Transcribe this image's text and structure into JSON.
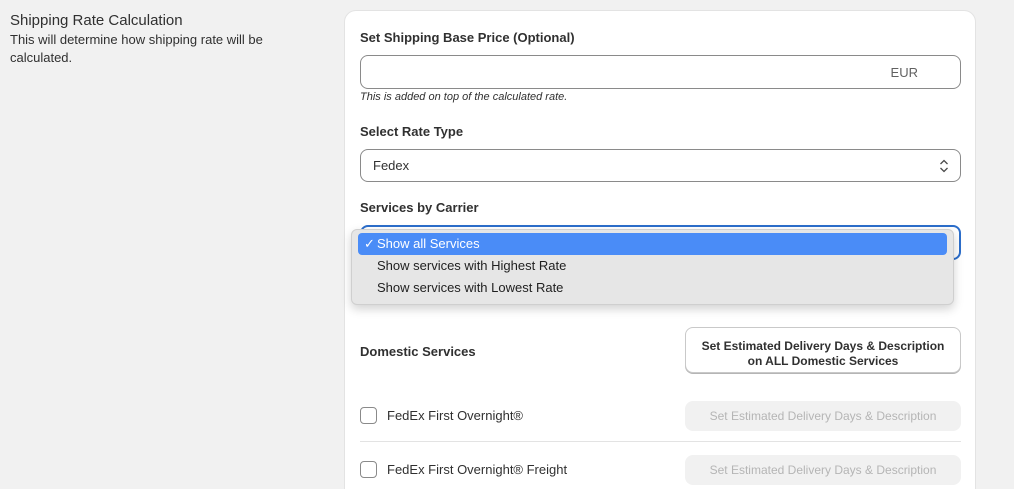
{
  "section": {
    "title": "Shipping Rate Calculation",
    "description": "This will determine how shipping rate will be calculated."
  },
  "base_price": {
    "label": "Set Shipping Base Price (Optional)",
    "value": "",
    "suffix": "EUR",
    "help": "This is added on top of the calculated rate."
  },
  "rate_type": {
    "label": "Select Rate Type",
    "selected": "Fedex"
  },
  "services_by_carrier": {
    "label": "Services by Carrier",
    "options": [
      {
        "label": "Show all Services",
        "selected": true
      },
      {
        "label": "Show services with Highest Rate",
        "selected": false
      },
      {
        "label": "Show services with Lowest Rate",
        "selected": false
      }
    ],
    "check_mark": "✓"
  },
  "domestic": {
    "label": "Domestic Services",
    "set_all_button_line1": "Set Estimated Delivery Days & Description",
    "set_all_button_line2": "on ALL Domestic Services",
    "services": [
      {
        "name": "FedEx First Overnight®",
        "checked": false,
        "button": "Set Estimated Delivery Days & Description"
      },
      {
        "name": "FedEx First Overnight® Freight",
        "checked": false,
        "button": "Set Estimated Delivery Days & Description"
      }
    ]
  },
  "colors": {
    "page_bg": "#f1f1f1",
    "focus_border": "#2c6ecb",
    "option_highlight": "#4a8cf7"
  }
}
